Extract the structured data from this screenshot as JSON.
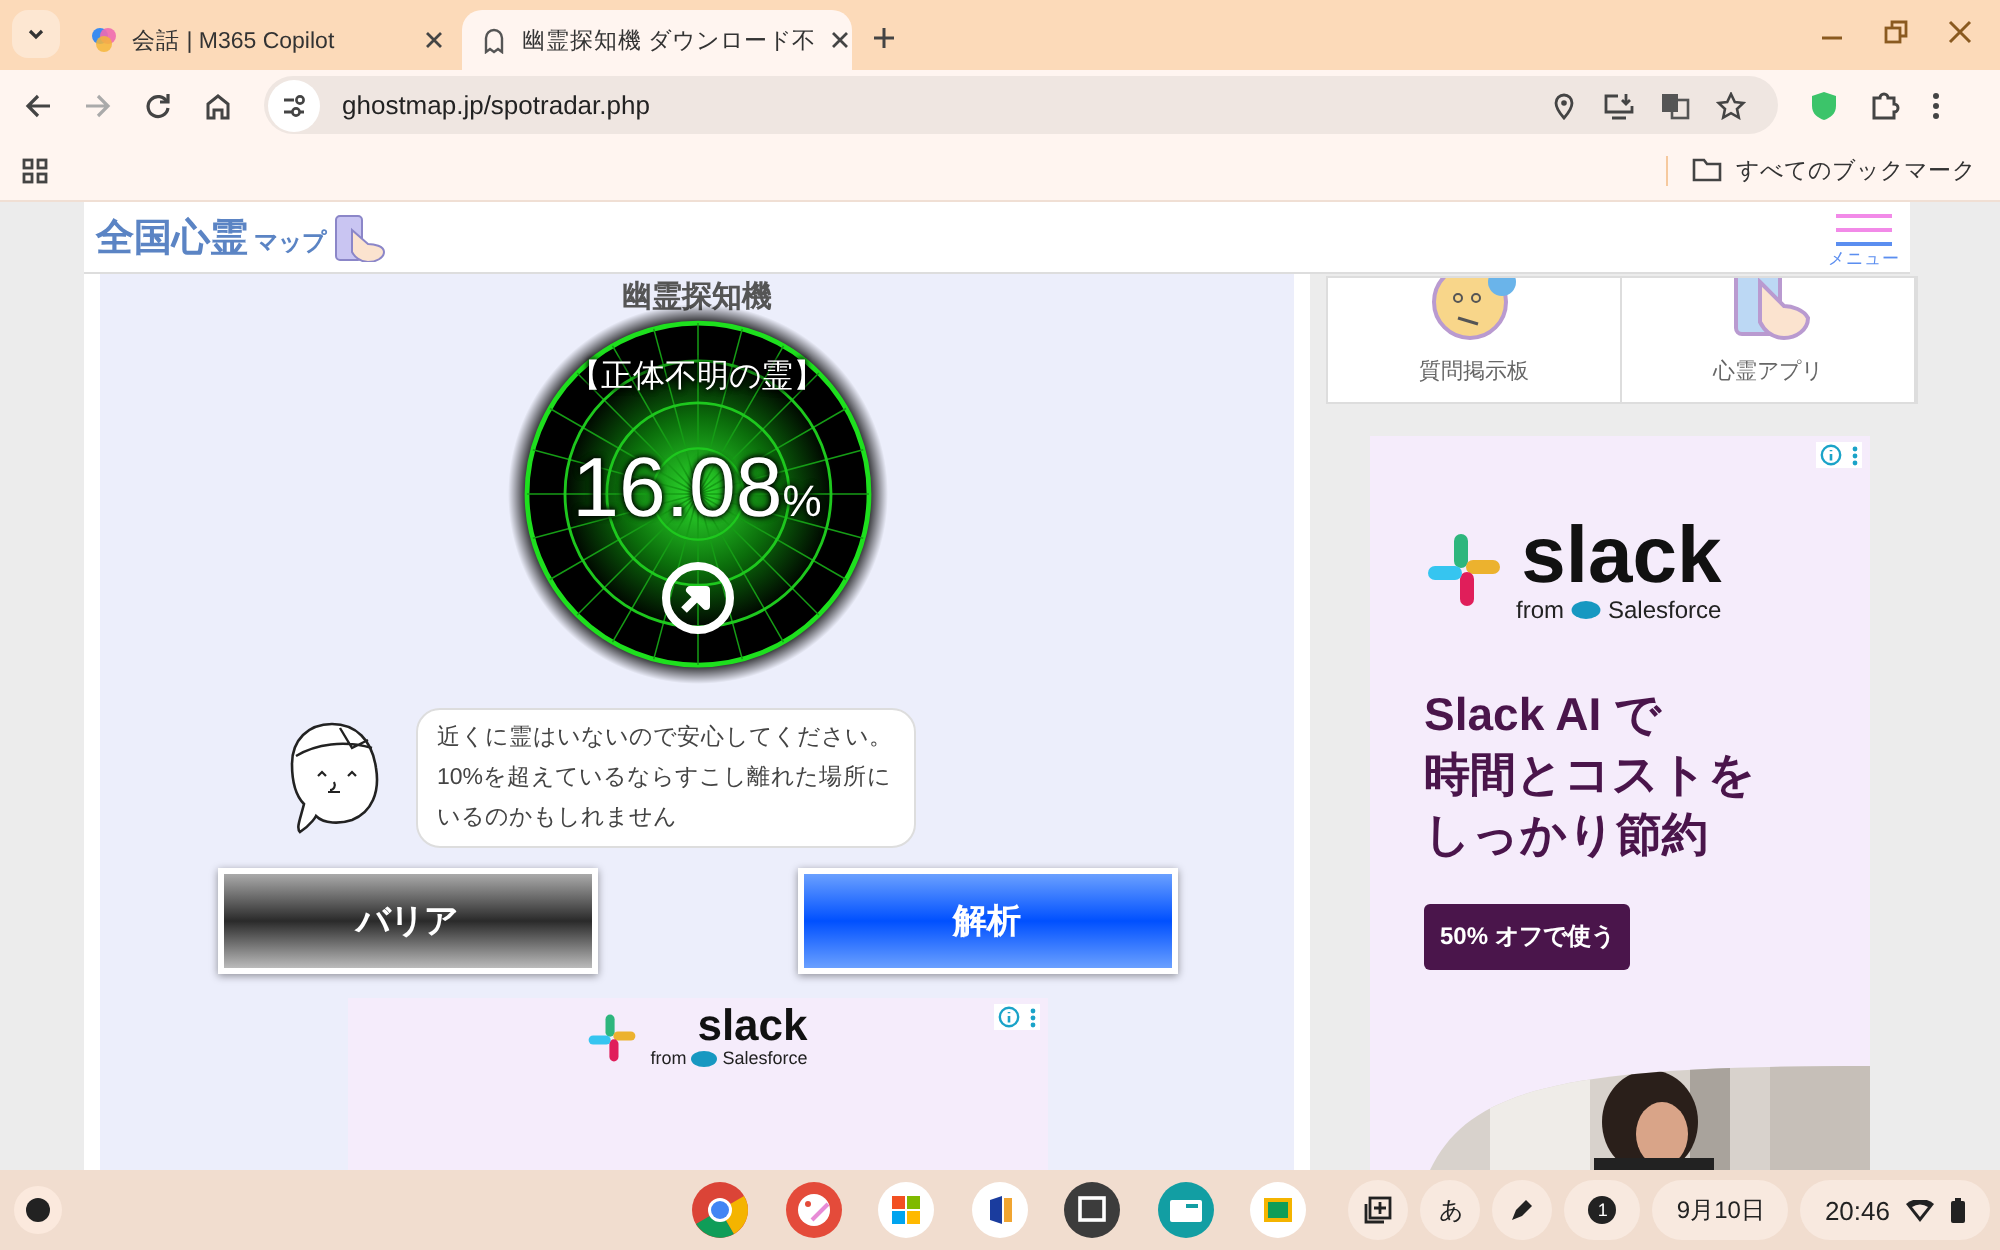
{
  "browser": {
    "tabs": [
      {
        "title": "会話 | M365 Copilot",
        "selected": false
      },
      {
        "title": "幽霊探知機 ダウンロード不",
        "selected": true
      }
    ],
    "address": "ghostmap.jp/spotradar.php",
    "bookmarks_label": "すべてのブックマーク"
  },
  "header": {
    "logo": [
      "全国心霊",
      "マップ"
    ],
    "menu_label": "メニュー"
  },
  "detector": {
    "title": "幽霊探知機",
    "spirit_type": "【正体不明の霊】",
    "percent": "16.08",
    "unit": "%",
    "message": "近くに霊はいないので安心してください。10%を超えているならすこし離れた場所にいるのかもしれません",
    "buttons": [
      {
        "label": "バリア",
        "kind": "barrier"
      },
      {
        "label": "解析",
        "kind": "analyze"
      }
    ]
  },
  "side_nav": [
    {
      "label": "質問掲示板"
    },
    {
      "label": "心霊アプリ"
    }
  ],
  "side_ad": {
    "brand": "slack",
    "from": "from",
    "partner": "Salesforce",
    "headline": [
      "Slack AI で",
      "時間とコストを",
      "しっかり節約"
    ],
    "cta": "50% オフで使う"
  },
  "bottom_ad": {
    "brand": "slack",
    "from": "from",
    "partner": "Salesforce"
  },
  "shelf": {
    "ime": "あ",
    "notifications": "1",
    "date": "9月10日",
    "time": "20:46"
  }
}
